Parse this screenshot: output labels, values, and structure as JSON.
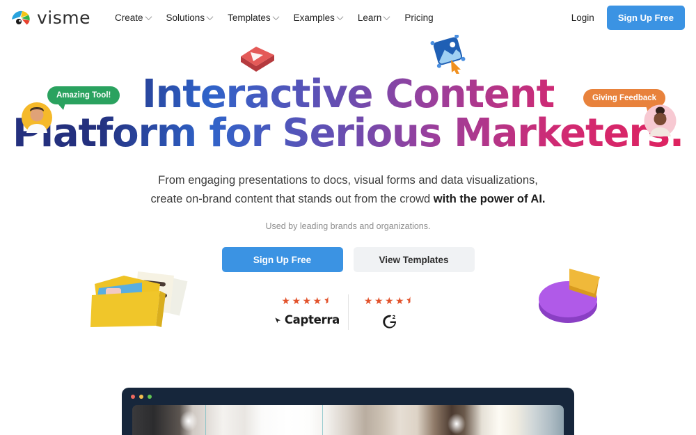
{
  "header": {
    "logo": {
      "icon": "visme-logo-icon",
      "wordmark": "visme"
    },
    "nav": [
      {
        "label": "Create",
        "has_dropdown": true
      },
      {
        "label": "Solutions",
        "has_dropdown": true
      },
      {
        "label": "Templates",
        "has_dropdown": true
      },
      {
        "label": "Examples",
        "has_dropdown": true
      },
      {
        "label": "Learn",
        "has_dropdown": true
      },
      {
        "label": "Pricing",
        "has_dropdown": false
      }
    ],
    "login_label": "Login",
    "signup_label": "Sign Up Free"
  },
  "hero": {
    "headline_line1": "Interactive Content",
    "headline_line2": "Platform for Serious Marketers.",
    "subhead_line1": "From engaging presentations to docs, visual forms and data visualizations,",
    "subhead_line2_normal": "create on-brand content that stands out from the crowd ",
    "subhead_line2_bold": "with the power of AI.",
    "usedby": "Used by leading brands and organizations.",
    "primary_cta": "Sign Up Free",
    "secondary_cta": "View Templates"
  },
  "testimonials": [
    {
      "text": "Amazing Tool!",
      "color": "#2aa25f",
      "avatar_name": "avatar-male-yellow"
    },
    {
      "text": "Giving Feedback",
      "color": "#e8823c",
      "avatar_name": "avatar-female-pink"
    }
  ],
  "ratings": [
    {
      "brand": "Capterra",
      "stars": 4.5,
      "stars_display": "★★★★",
      "icon": "capterra-arrow-icon"
    },
    {
      "brand": "G2",
      "stars": 4.5,
      "stars_display": "★★★★",
      "icon": "g2-logo-icon"
    }
  ],
  "decorations": [
    {
      "name": "video-play-tile-3d",
      "color": "#e05453"
    },
    {
      "name": "image-placeholder-3d",
      "color": "#1f5fb4"
    },
    {
      "name": "folder-documents-3d",
      "color": "#efc325"
    },
    {
      "name": "pie-chart-3d",
      "color": "#a855e0"
    }
  ],
  "video_preview": {
    "name": "product-video-window",
    "window_dots": [
      "#ee6a5f",
      "#f4bf4f",
      "#61c554"
    ]
  },
  "colors": {
    "accent_blue": "#3b93e3",
    "headline_start": "#24307e",
    "headline_end": "#e0215c",
    "star": "#e2522b"
  }
}
